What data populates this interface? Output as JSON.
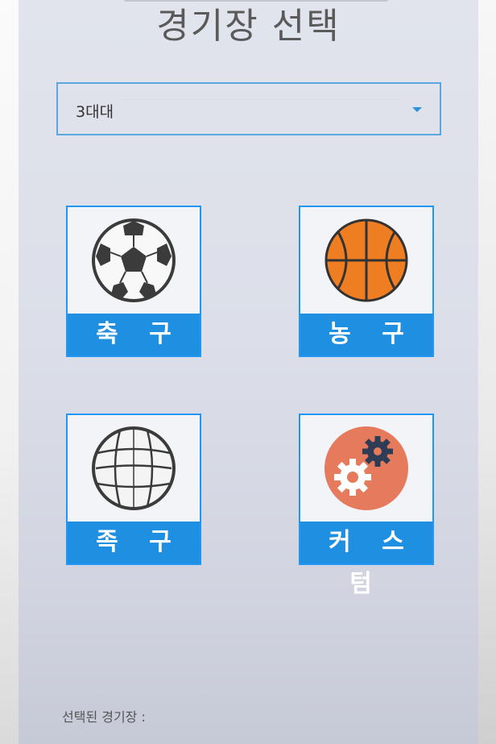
{
  "title": "경기장 선택",
  "dropdown": {
    "selected": "3대대"
  },
  "tiles": [
    {
      "label": "축 구",
      "icon": "soccer-ball-icon"
    },
    {
      "label": "농 구",
      "icon": "basketball-icon"
    },
    {
      "label": "족 구",
      "icon": "volleyball-icon"
    },
    {
      "label": "커 스 텀",
      "icon": "gears-icon"
    }
  ],
  "footer": {
    "selected_label": "선택된 경기장 :"
  },
  "colors": {
    "accent": "#1f8fe2",
    "basketball": "#ef7d22",
    "custom_bg": "#e67a5d",
    "gear_dark": "#2e3c55"
  }
}
